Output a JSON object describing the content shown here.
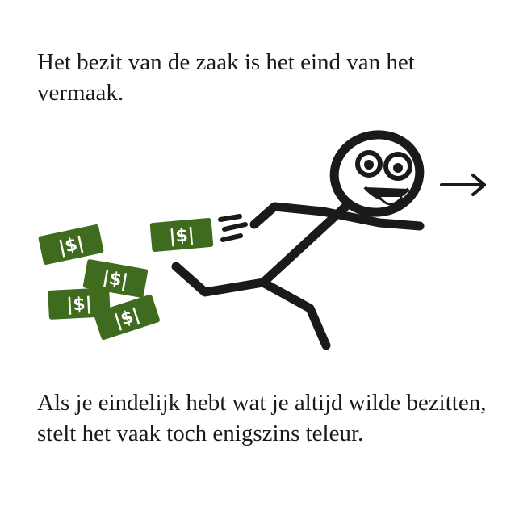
{
  "caption_top": "Het bezit van de zaak is het eind van het vermaak.",
  "caption_bottom": "Als je eindelijk hebt wat je altijd wilde bezitten, stelt het vaak toch enigszins teleur.",
  "bill_label": "|$|",
  "colors": {
    "bill_green": "#3e6b1d",
    "ink": "#1a1a1a"
  },
  "icons": [
    "stick-figure",
    "money-bill",
    "arrow-right"
  ]
}
